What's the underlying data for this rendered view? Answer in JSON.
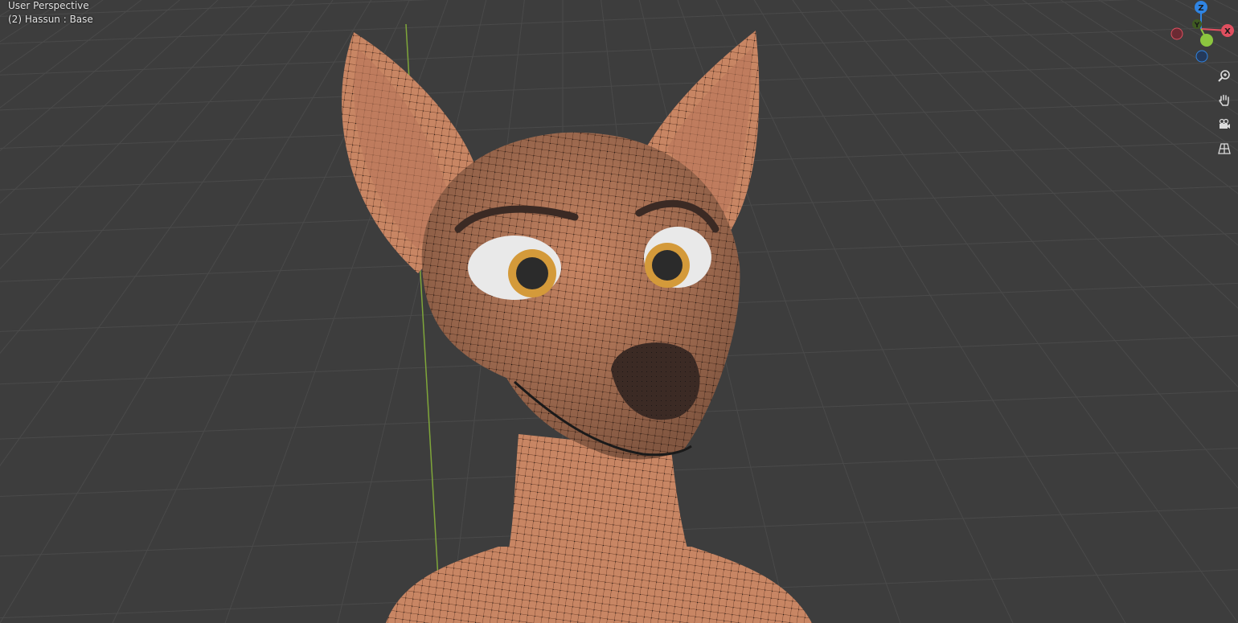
{
  "viewport": {
    "view_name": "User Perspective",
    "object_info": "(2) Hassun : Base",
    "background_color": "#3d3d3d",
    "grid_color": "#4a4a4a",
    "y_axis_color": "#7fa63a",
    "mesh_color": "#c88664",
    "wireframe_color": "#111111"
  },
  "gizmo": {
    "z_label": "Z",
    "x_label": "X",
    "y_label": "Y",
    "x_color": "#e04f5f",
    "y_color": "#8cc63f",
    "z_color": "#2f84e3"
  },
  "navigation": [
    {
      "icon": "zoom-icon",
      "tooltip": "Zoom"
    },
    {
      "icon": "hand-pan-icon",
      "tooltip": "Move"
    },
    {
      "icon": "camera-icon",
      "tooltip": "Camera View"
    },
    {
      "icon": "grid-perspective-icon",
      "tooltip": "Perspective/Orthographic"
    }
  ]
}
